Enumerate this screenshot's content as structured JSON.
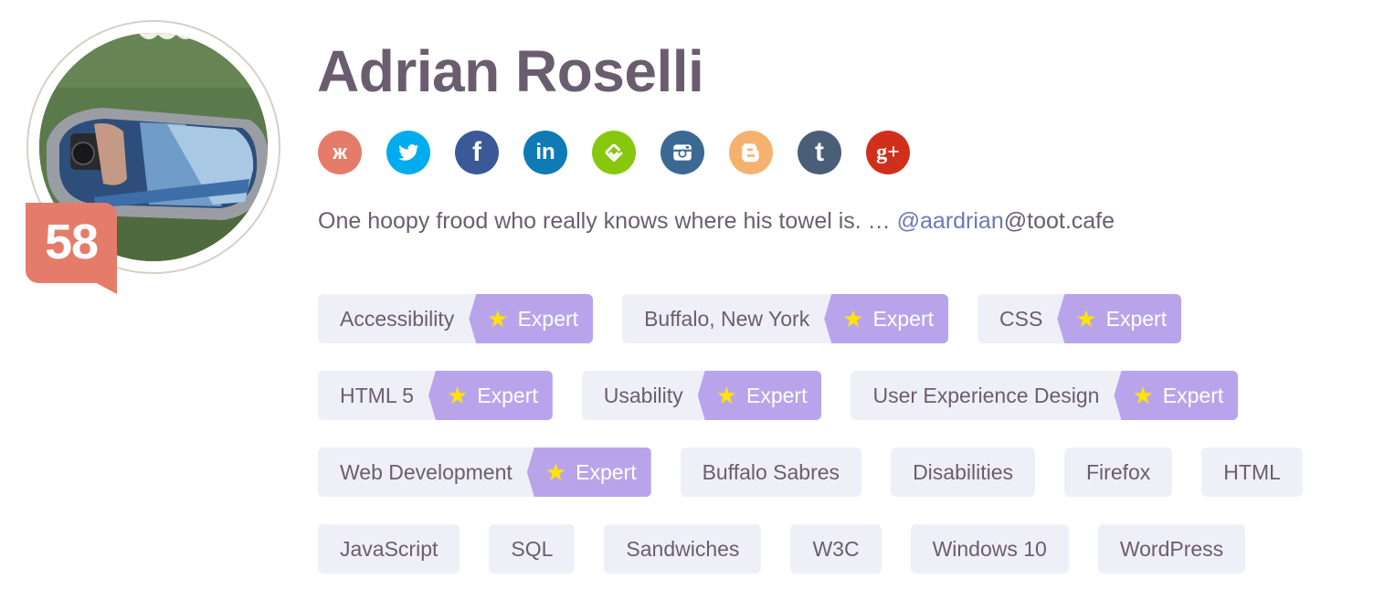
{
  "profile": {
    "name": "Adrian Roselli",
    "score": "58",
    "bio_text": "One hoopy frood who really knows where his towel is. … ",
    "bio_mention": "@aardrian",
    "bio_suffix": "@toot.cafe"
  },
  "social": [
    {
      "name": "klout",
      "icon": "klout-icon",
      "glyph": "ж",
      "color": "#e57c6a"
    },
    {
      "name": "twitter",
      "icon": "twitter-icon",
      "glyph": "",
      "color": "#00aced"
    },
    {
      "name": "facebook",
      "icon": "facebook-icon",
      "glyph": "f",
      "color": "#3b5998"
    },
    {
      "name": "linkedin",
      "icon": "linkedin-icon",
      "glyph": "in",
      "color": "#0e7bb5"
    },
    {
      "name": "feedly",
      "icon": "feedly-icon",
      "glyph": "",
      "color": "#87c80f"
    },
    {
      "name": "instagram",
      "icon": "instagram-icon",
      "glyph": "",
      "color": "#3b6994"
    },
    {
      "name": "blogger",
      "icon": "blogger-icon",
      "glyph": "",
      "color": "#f5b26e"
    },
    {
      "name": "tumblr",
      "icon": "tumblr-icon",
      "glyph": "t",
      "color": "#4a5e77"
    },
    {
      "name": "google-plus",
      "icon": "google-plus-icon",
      "glyph": "g+",
      "color": "#d0301b"
    }
  ],
  "expert_label": "Expert",
  "tags": [
    [
      {
        "label": "Accessibility",
        "expert": true
      },
      {
        "label": "Buffalo, New York",
        "expert": true
      },
      {
        "label": "CSS",
        "expert": true
      }
    ],
    [
      {
        "label": "HTML 5",
        "expert": true
      },
      {
        "label": "Usability",
        "expert": true
      },
      {
        "label": "User Experience Design",
        "expert": true
      }
    ],
    [
      {
        "label": "Web Development",
        "expert": true
      },
      {
        "label": "Buffalo Sabres",
        "expert": false
      },
      {
        "label": "Disabilities",
        "expert": false
      },
      {
        "label": "Firefox",
        "expert": false
      },
      {
        "label": "HTML",
        "expert": false
      }
    ],
    [
      {
        "label": "JavaScript",
        "expert": false
      },
      {
        "label": "SQL",
        "expert": false
      },
      {
        "label": "Sandwiches",
        "expert": false
      },
      {
        "label": "W3C",
        "expert": false
      },
      {
        "label": "Windows 10",
        "expert": false
      },
      {
        "label": "WordPress",
        "expert": false
      }
    ]
  ]
}
